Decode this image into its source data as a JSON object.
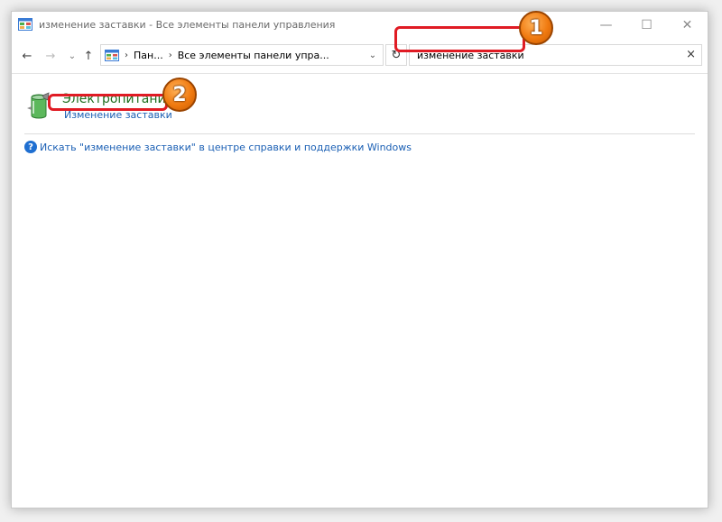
{
  "window": {
    "title": "изменение заставки - Все элементы панели управления",
    "controls": {
      "minimize": "—",
      "maximize": "☐",
      "close": "✕"
    }
  },
  "navbar": {
    "back": "←",
    "forward": "→",
    "recent": "⌄",
    "up": "↑",
    "breadcrumb": [
      "Пан...",
      "Все элементы панели упра..."
    ],
    "separator": "›",
    "dropdown": "⌄",
    "refresh": "↻"
  },
  "search": {
    "value": "изменение заставки",
    "clear": "×"
  },
  "results": {
    "title": "Электропитание",
    "link": "Изменение заставки"
  },
  "help": {
    "icon": "?",
    "link": "Искать \"изменение заставки\" в центре справки и поддержки Windows"
  },
  "annotations": {
    "marker1": "1",
    "marker2": "2",
    "highlight_color": "#e01b24",
    "marker_color": "#f07a10"
  }
}
